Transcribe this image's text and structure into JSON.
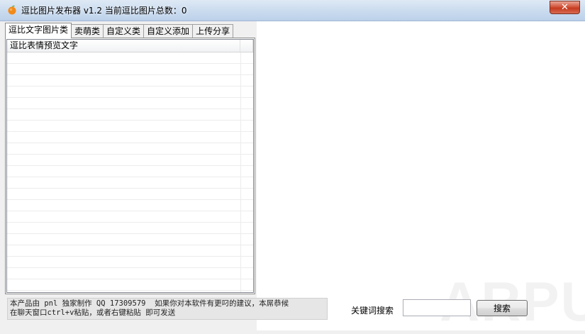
{
  "window": {
    "title": "逗比图片发布器 v1.2 当前逗比图片总数：0",
    "close_label": "✕",
    "accent": "#c43b20"
  },
  "tabs": [
    {
      "label": "逗比文字图片类",
      "active": true
    },
    {
      "label": "卖萌类",
      "active": false
    },
    {
      "label": "自定义类",
      "active": false
    },
    {
      "label": "自定义添加",
      "active": false
    },
    {
      "label": "上传分享",
      "active": false
    }
  ],
  "list": {
    "columns": [
      "逗比表情预览文字",
      ""
    ],
    "rows": []
  },
  "info": {
    "text": "本产品由 pnl 独家制作 QQ 17309579  如果你对本软件有更叼的建议，本屌恭候\n在聊天窗口ctrl+v粘贴，或者右键粘贴 即可发送"
  },
  "search": {
    "label": "关键词搜索",
    "value": "",
    "button_label": "搜索"
  },
  "watermark": {
    "text": "ARPUN"
  }
}
